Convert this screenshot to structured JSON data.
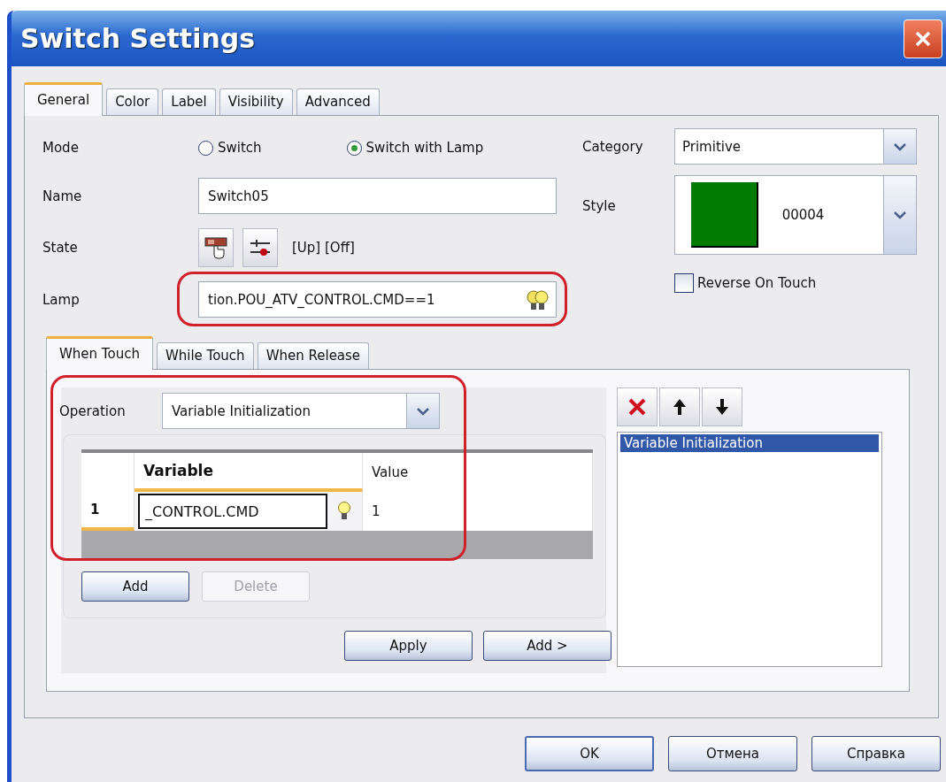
{
  "window": {
    "title": "Switch Settings"
  },
  "tabs": [
    {
      "label": "General",
      "selected": true
    },
    {
      "label": "Color",
      "selected": false
    },
    {
      "label": "Label",
      "selected": false
    },
    {
      "label": "Visibility",
      "selected": false
    },
    {
      "label": "Advanced",
      "selected": false
    }
  ],
  "general": {
    "mode": {
      "label": "Mode",
      "options": [
        {
          "label": "Switch",
          "selected": false
        },
        {
          "label": "Switch with Lamp",
          "selected": true
        }
      ]
    },
    "category": {
      "label": "Category",
      "value": "Primitive"
    },
    "name": {
      "label": "Name",
      "value": "Switch05"
    },
    "style": {
      "label": "Style",
      "color": "#007b00",
      "code": "00004"
    },
    "state": {
      "label": "State",
      "value": "[Up] [Off]"
    },
    "lamp": {
      "label": "Lamp",
      "value": "tion.POU_ATV_CONTROL.CMD==1",
      "highlighted": true
    },
    "reverse_on_touch": {
      "label": "Reverse On Touch",
      "checked": false
    },
    "action_tabs": [
      {
        "label": "When Touch",
        "selected": true
      },
      {
        "label": "While Touch",
        "selected": false
      },
      {
        "label": "When Release",
        "selected": false
      }
    ],
    "operation": {
      "label": "Operation",
      "value": "Variable Initialization",
      "highlighted": true
    },
    "table": {
      "columns": [
        {
          "label": "Variable",
          "current": true
        },
        {
          "label": "Value",
          "current": false
        }
      ],
      "rows": [
        {
          "index": "1",
          "variable": "_CONTROL.CMD",
          "value": "1",
          "current": true,
          "editing": true
        }
      ]
    },
    "table_buttons": [
      {
        "label": "Add",
        "disabled": false
      },
      {
        "label": "Delete",
        "disabled": true
      }
    ],
    "action_buttons": [
      {
        "label": "Apply"
      },
      {
        "label": "Add >"
      }
    ],
    "action_list": [
      {
        "label": "Variable Initialization",
        "selected": true
      }
    ]
  },
  "buttons": [
    {
      "label": "OK",
      "default": true
    },
    {
      "label": "Отмена",
      "default": false
    },
    {
      "label": "Справка",
      "default": false
    }
  ]
}
